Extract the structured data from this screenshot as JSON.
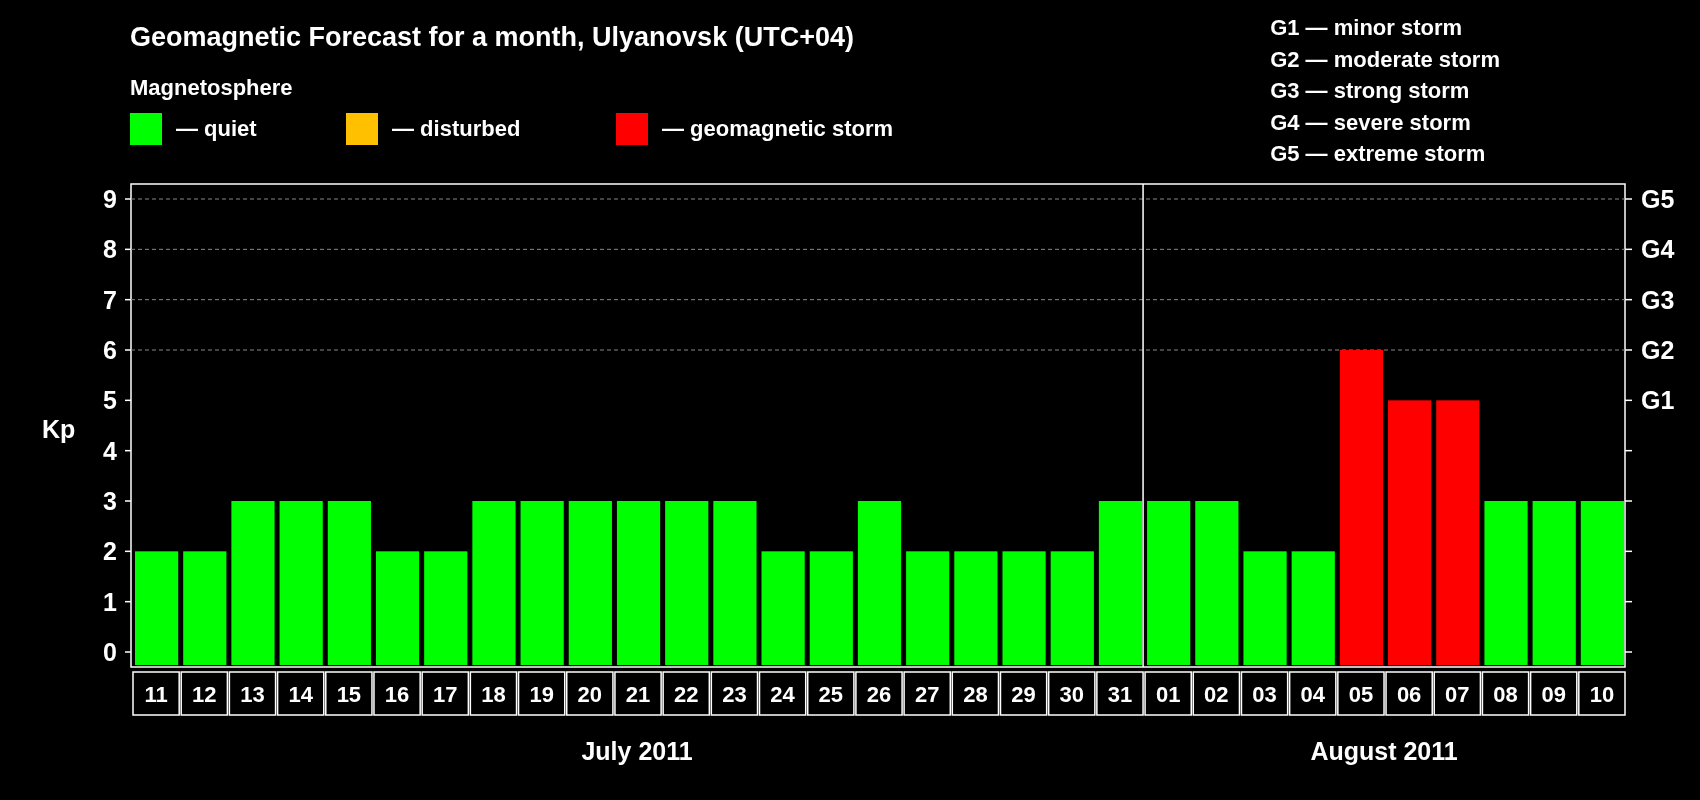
{
  "title": "Geomagnetic Forecast for a month, Ulyanovsk (UTC+04)",
  "legend_heading": "Magnetosphere",
  "legend": [
    {
      "label": "— quiet",
      "color": "#00ff00"
    },
    {
      "label": "— disturbed",
      "color": "#ffc000"
    },
    {
      "label": "— geomagnetic storm",
      "color": "#ff0000"
    }
  ],
  "g_scale": [
    "G1 — minor storm",
    "G2 — moderate storm",
    "G3 — strong storm",
    "G4 — severe storm",
    "G5 — extreme storm"
  ],
  "chart_data": {
    "type": "bar",
    "ylabel": "Kp",
    "categories": [
      "11",
      "12",
      "13",
      "14",
      "15",
      "16",
      "17",
      "18",
      "19",
      "20",
      "21",
      "22",
      "23",
      "24",
      "25",
      "26",
      "27",
      "28",
      "29",
      "30",
      "31",
      "01",
      "02",
      "03",
      "04",
      "05",
      "06",
      "07",
      "08",
      "09",
      "10"
    ],
    "values": [
      2,
      2,
      3,
      3,
      3,
      2,
      2,
      3,
      3,
      3,
      3,
      3,
      3,
      2,
      2,
      3,
      2,
      2,
      2,
      2,
      3,
      3,
      3,
      2,
      2,
      6,
      5,
      5,
      3,
      3,
      3
    ],
    "ylim": [
      0,
      9
    ],
    "yticks": [
      0,
      1,
      2,
      3,
      4,
      5,
      6,
      7,
      8,
      9
    ],
    "grid": true,
    "ref_lines": [
      {
        "axis": "x",
        "value": "01"
      }
    ],
    "annotations": [
      "July 2011",
      "August 2011"
    ]
  },
  "storm_levels": [
    "G5",
    "G4",
    "G3",
    "G2",
    "G1"
  ]
}
